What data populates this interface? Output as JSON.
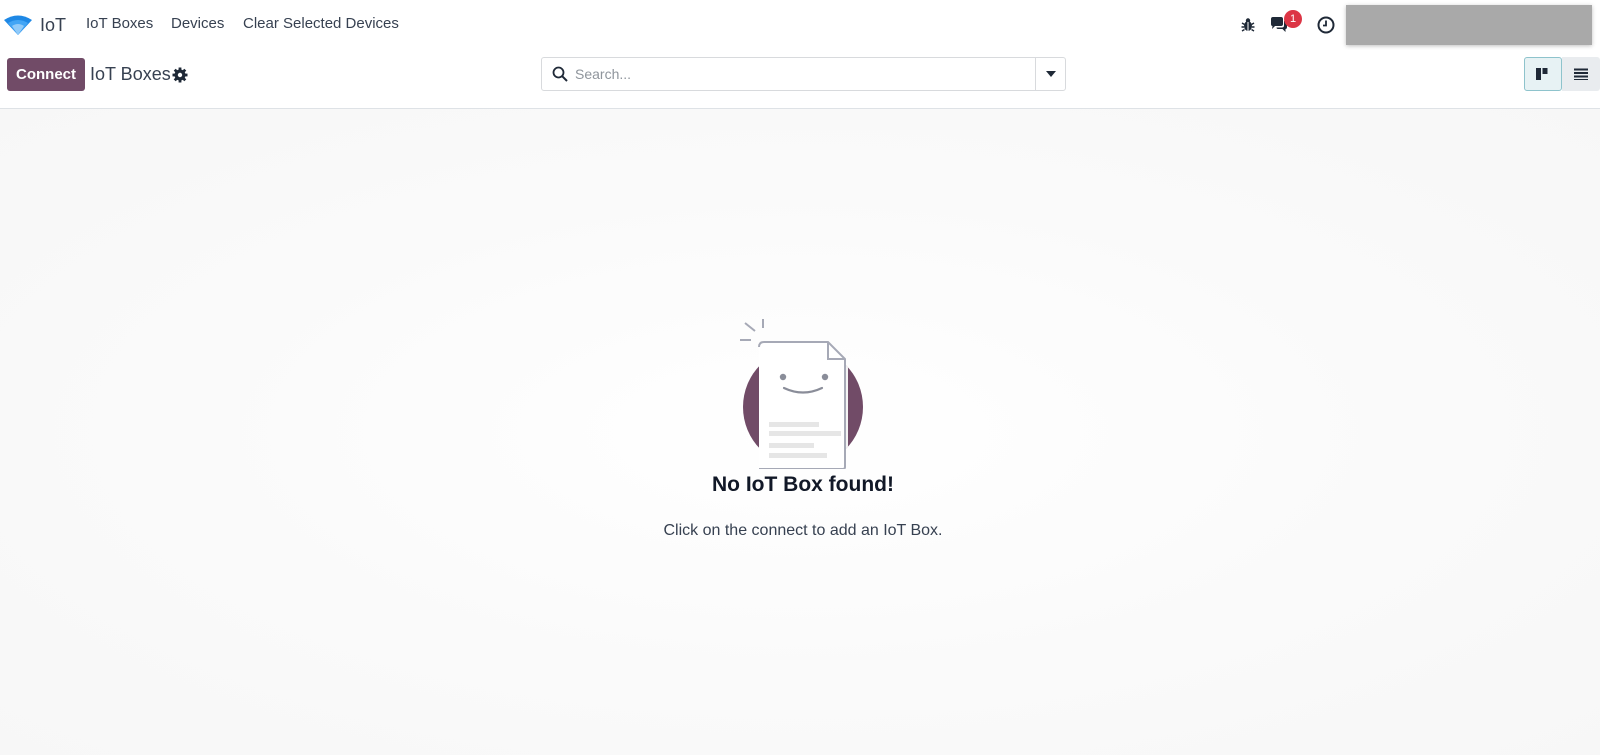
{
  "navbar": {
    "app_name": "IoT",
    "menu": {
      "iot_boxes": "IoT Boxes",
      "devices": "Devices",
      "clear_selected": "Clear Selected Devices"
    },
    "systray": {
      "messages_count": "1",
      "icons": [
        "debug-icon",
        "chat-icon",
        "clock-icon"
      ]
    }
  },
  "control_panel": {
    "connect_label": "Connect",
    "title": "IoT Boxes",
    "search_placeholder": "Search...",
    "active_view": "kanban",
    "views": [
      "kanban",
      "list"
    ]
  },
  "helper": {
    "title": "No IoT Box found!",
    "text": "Click on the connect to add an IoT Box."
  },
  "colors": {
    "brand": "#714b67",
    "badge": "#dc3545"
  }
}
